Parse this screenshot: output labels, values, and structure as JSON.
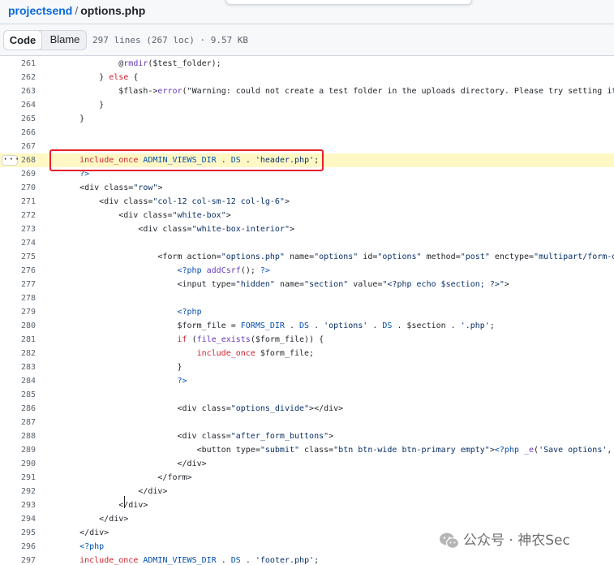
{
  "breadcrumb": {
    "repo": "projectsend",
    "separator": "/",
    "file": "options.php"
  },
  "toolbar": {
    "code_label": "Code",
    "blame_label": "Blame",
    "file_info": "297 lines (267 loc) · 9.57 KB"
  },
  "code": {
    "highlighted_line": "268",
    "lines": [
      {
        "n": "261",
        "t": "            @rmdir($test_folder);"
      },
      {
        "n": "262",
        "t": "        } else {"
      },
      {
        "n": "263",
        "t": "            $flash->error(\"Warning: could not create a test folder in the uploads directory. Please try setting it's permission"
      },
      {
        "n": "264",
        "t": "        }"
      },
      {
        "n": "265",
        "t": "    }"
      },
      {
        "n": "266",
        "t": ""
      },
      {
        "n": "267",
        "t": ""
      },
      {
        "n": "268",
        "t": "    include_once ADMIN_VIEWS_DIR . DS . 'header.php';"
      },
      {
        "n": "269",
        "t": "    ?>"
      },
      {
        "n": "270",
        "t": "    <div class=\"row\">"
      },
      {
        "n": "271",
        "t": "        <div class=\"col-12 col-sm-12 col-lg-6\">"
      },
      {
        "n": "272",
        "t": "            <div class=\"white-box\">"
      },
      {
        "n": "273",
        "t": "                <div class=\"white-box-interior\">"
      },
      {
        "n": "274",
        "t": ""
      },
      {
        "n": "275",
        "t": "                    <form action=\"options.php\" name=\"options\" id=\"options\" method=\"post\" enctype=\"multipart/form-data\" class=\"f"
      },
      {
        "n": "276",
        "t": "                        <?php addCsrf(); ?>"
      },
      {
        "n": "277",
        "t": "                        <input type=\"hidden\" name=\"section\" value=\"<?php echo $section; ?>\">"
      },
      {
        "n": "278",
        "t": ""
      },
      {
        "n": "279",
        "t": "                        <?php"
      },
      {
        "n": "280",
        "t": "                        $form_file = FORMS_DIR . DS . 'options' . DS . $section . '.php';"
      },
      {
        "n": "281",
        "t": "                        if (file_exists($form_file)) {"
      },
      {
        "n": "282",
        "t": "                            include_once $form_file;"
      },
      {
        "n": "283",
        "t": "                        }"
      },
      {
        "n": "284",
        "t": "                        ?>"
      },
      {
        "n": "285",
        "t": ""
      },
      {
        "n": "286",
        "t": "                        <div class=\"options_divide\"></div>"
      },
      {
        "n": "287",
        "t": ""
      },
      {
        "n": "288",
        "t": "                        <div class=\"after_form_buttons\">"
      },
      {
        "n": "289",
        "t": "                            <button type=\"submit\" class=\"btn btn-wide btn-primary empty\"><?php _e('Save options', 'cftp_admin')"
      },
      {
        "n": "290",
        "t": "                        </div>"
      },
      {
        "n": "291",
        "t": "                    </form>"
      },
      {
        "n": "292",
        "t": "                </div>"
      },
      {
        "n": "293",
        "t": "            </div>"
      },
      {
        "n": "294",
        "t": "        </div>"
      },
      {
        "n": "295",
        "t": "    </div>"
      },
      {
        "n": "296",
        "t": "    <?php"
      },
      {
        "n": "297",
        "t": "    include_once ADMIN_VIEWS_DIR . DS . 'footer.php';"
      }
    ]
  },
  "watermark": {
    "text": "公众号 · 神农Sec",
    "icon": "wechat-icon"
  },
  "colors": {
    "highlight_bg": "#fff8c5",
    "annotation_box": "#e5212a",
    "link": "#0969da",
    "keyword": "#cf222e",
    "string": "#0a3069",
    "function": "#6639ba",
    "constant": "#0550ae"
  }
}
